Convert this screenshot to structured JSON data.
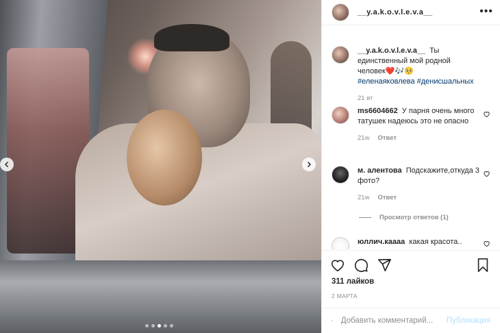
{
  "post": {
    "author": "__y.a.k.o.v.l.e.v.a__",
    "more_glyph": "•••",
    "caption": {
      "user": "__y.a.k.o.v.l.e.v.a__",
      "text": "Ты единственный мой родной человек",
      "emoji": "❤️🎶🥺",
      "hashtags": "#еленаяковлева #денисшальных",
      "time": "21 вт"
    },
    "carousel": {
      "count": 5,
      "active": 3
    },
    "likes": "311 лайков",
    "date": "2 МАРТА"
  },
  "comments": [
    {
      "user": "ms6604662",
      "text": "У парня очень много татушек надеюсь это не опасно",
      "time": "21w",
      "reply": "Ответ"
    },
    {
      "user": "м. алентова",
      "text": "Подскажите,откуда 3 фото?",
      "time": "21w",
      "reply": "Ответ"
    },
    {
      "user": "юллич.каааа",
      "text": "какая красота.."
    }
  ],
  "view_replies": "Просмотр ответов (1)",
  "composer": {
    "placeholder": "Добавить комментарий...",
    "publish": "Публикация"
  },
  "colors": {
    "link": "#00376b",
    "muted": "#8e8e8e",
    "publish_disabled": "#b2dffc"
  }
}
